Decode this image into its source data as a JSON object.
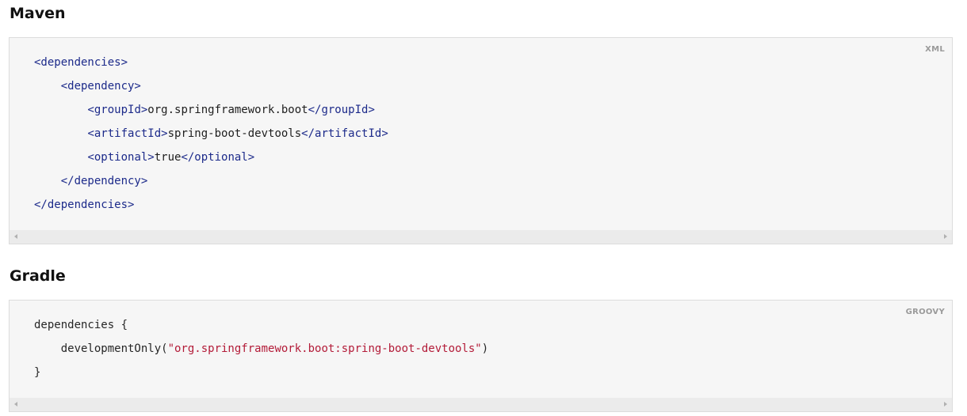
{
  "sections": {
    "maven": {
      "title": "Maven",
      "language": "XML",
      "lines": [
        {
          "indent": "",
          "parts": [
            {
              "t": "<dependencies>",
              "k": "tag"
            }
          ]
        },
        {
          "indent": "    ",
          "parts": [
            {
              "t": "<dependency>",
              "k": "tag"
            }
          ]
        },
        {
          "indent": "        ",
          "parts": [
            {
              "t": "<groupId>",
              "k": "tag"
            },
            {
              "t": "org.springframework.boot",
              "k": "txt"
            },
            {
              "t": "</groupId>",
              "k": "tag"
            }
          ]
        },
        {
          "indent": "        ",
          "parts": [
            {
              "t": "<artifactId>",
              "k": "tag"
            },
            {
              "t": "spring-boot-devtools",
              "k": "txt"
            },
            {
              "t": "</artifactId>",
              "k": "tag"
            }
          ]
        },
        {
          "indent": "        ",
          "parts": [
            {
              "t": "<optional>",
              "k": "tag"
            },
            {
              "t": "true",
              "k": "txt"
            },
            {
              "t": "</optional>",
              "k": "tag"
            }
          ]
        },
        {
          "indent": "    ",
          "parts": [
            {
              "t": "</dependency>",
              "k": "tag"
            }
          ]
        },
        {
          "indent": "",
          "parts": [
            {
              "t": "</dependencies>",
              "k": "tag"
            }
          ]
        }
      ]
    },
    "gradle": {
      "title": "Gradle",
      "language": "GROOVY",
      "lines": [
        {
          "indent": "",
          "parts": [
            {
              "t": "dependencies {",
              "k": "plain"
            }
          ]
        },
        {
          "indent": "    ",
          "parts": [
            {
              "t": "developmentOnly(",
              "k": "plain"
            },
            {
              "t": "\"org.springframework.boot:spring-boot-devtools\"",
              "k": "str"
            },
            {
              "t": ")",
              "k": "plain"
            }
          ]
        },
        {
          "indent": "",
          "parts": [
            {
              "t": "}",
              "k": "plain"
            }
          ]
        }
      ]
    }
  }
}
